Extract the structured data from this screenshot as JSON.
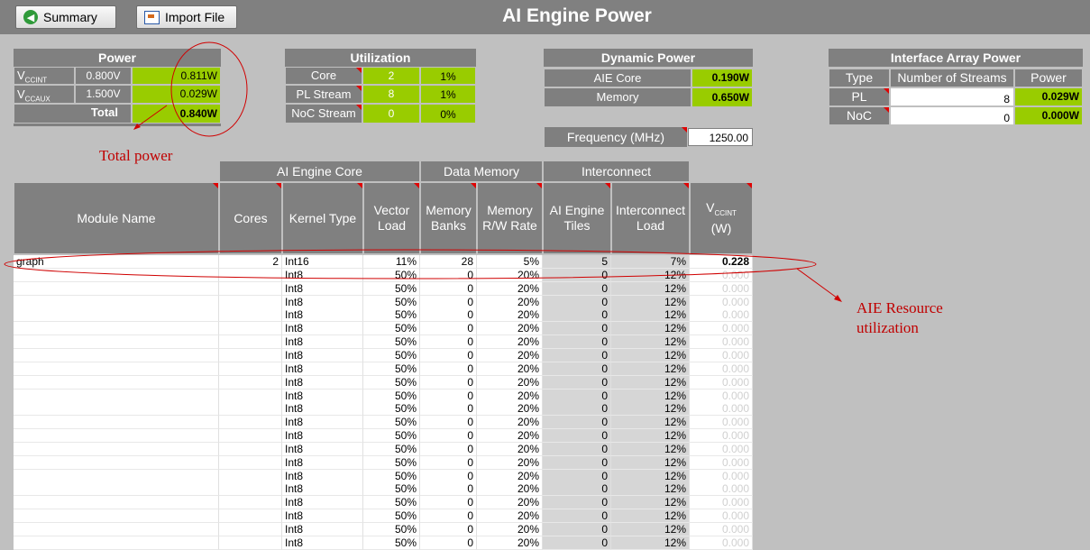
{
  "toolbar": {
    "summary_label": "Summary",
    "import_label": "Import File"
  },
  "title": "AI Engine Power",
  "power": {
    "header": "Power",
    "rows": [
      {
        "label": "V",
        "sub": "CCINT",
        "volt": "0.800V",
        "watt": "0.811W"
      },
      {
        "label": "V",
        "sub": "CCAUX",
        "volt": "1.500V",
        "watt": "0.029W"
      }
    ],
    "total_label": "Total",
    "total_value": "0.840W"
  },
  "utilization": {
    "header": "Utilization",
    "rows": [
      {
        "label": "Core",
        "count": "2",
        "pct": "1%"
      },
      {
        "label": "PL Stream",
        "count": "8",
        "pct": "1%"
      },
      {
        "label": "NoC Stream",
        "count": "0",
        "pct": "0%"
      }
    ]
  },
  "dynamic": {
    "header": "Dynamic Power",
    "rows": [
      {
        "label": "AIE Core",
        "value": "0.190W"
      },
      {
        "label": "Memory",
        "value": "0.650W"
      }
    ],
    "freq_label": "Frequency (MHz)",
    "freq_value": "1250.00"
  },
  "interface": {
    "header": "Interface Array Power",
    "cols": [
      "Type",
      "Number of Streams",
      "Power"
    ],
    "rows": [
      {
        "type": "PL",
        "streams": "8",
        "power": "0.029W"
      },
      {
        "type": "NoC",
        "streams": "0",
        "power": "0.000W"
      }
    ]
  },
  "annotations": {
    "total_power": "Total power",
    "resource_line1": "AIE Resource",
    "resource_line2": "utilization"
  },
  "table": {
    "groups": [
      "AI Engine Core",
      "Data Memory",
      "Interconnect"
    ],
    "headers": {
      "module": "Module Name",
      "cores": "Cores",
      "kernel": "Kernel Type",
      "vector1": "Vector",
      "vector2": "Load",
      "membanks1": "Memory",
      "membanks2": "Banks",
      "memrw1": "Memory",
      "memrw2": "R/W Rate",
      "tiles1": "AI Engine",
      "tiles2": "Tiles",
      "icload1": "Interconnect",
      "icload2": "Load",
      "vcc": "V",
      "vcc_sub": "CCINT",
      "vcc_unit": "(W)"
    },
    "rows": [
      {
        "module": "graph",
        "cores": "2",
        "kernel": "Int16",
        "vector": "11%",
        "banks": "28",
        "rw": "5%",
        "tiles": "5",
        "icload": "7%",
        "vcc": "0.228"
      },
      {
        "module": "",
        "cores": "",
        "kernel": "Int8",
        "vector": "50%",
        "banks": "0",
        "rw": "20%",
        "tiles": "0",
        "icload": "12%",
        "vcc": "0.000"
      },
      {
        "module": "",
        "cores": "",
        "kernel": "Int8",
        "vector": "50%",
        "banks": "0",
        "rw": "20%",
        "tiles": "0",
        "icload": "12%",
        "vcc": "0.000"
      },
      {
        "module": "",
        "cores": "",
        "kernel": "Int8",
        "vector": "50%",
        "banks": "0",
        "rw": "20%",
        "tiles": "0",
        "icload": "12%",
        "vcc": "0.000"
      },
      {
        "module": "",
        "cores": "",
        "kernel": "Int8",
        "vector": "50%",
        "banks": "0",
        "rw": "20%",
        "tiles": "0",
        "icload": "12%",
        "vcc": "0.000"
      },
      {
        "module": "",
        "cores": "",
        "kernel": "Int8",
        "vector": "50%",
        "banks": "0",
        "rw": "20%",
        "tiles": "0",
        "icload": "12%",
        "vcc": "0.000"
      },
      {
        "module": "",
        "cores": "",
        "kernel": "Int8",
        "vector": "50%",
        "banks": "0",
        "rw": "20%",
        "tiles": "0",
        "icload": "12%",
        "vcc": "0.000"
      },
      {
        "module": "",
        "cores": "",
        "kernel": "Int8",
        "vector": "50%",
        "banks": "0",
        "rw": "20%",
        "tiles": "0",
        "icload": "12%",
        "vcc": "0.000"
      },
      {
        "module": "",
        "cores": "",
        "kernel": "Int8",
        "vector": "50%",
        "banks": "0",
        "rw": "20%",
        "tiles": "0",
        "icload": "12%",
        "vcc": "0.000"
      },
      {
        "module": "",
        "cores": "",
        "kernel": "Int8",
        "vector": "50%",
        "banks": "0",
        "rw": "20%",
        "tiles": "0",
        "icload": "12%",
        "vcc": "0.000"
      },
      {
        "module": "",
        "cores": "",
        "kernel": "Int8",
        "vector": "50%",
        "banks": "0",
        "rw": "20%",
        "tiles": "0",
        "icload": "12%",
        "vcc": "0.000"
      },
      {
        "module": "",
        "cores": "",
        "kernel": "Int8",
        "vector": "50%",
        "banks": "0",
        "rw": "20%",
        "tiles": "0",
        "icload": "12%",
        "vcc": "0.000"
      },
      {
        "module": "",
        "cores": "",
        "kernel": "Int8",
        "vector": "50%",
        "banks": "0",
        "rw": "20%",
        "tiles": "0",
        "icload": "12%",
        "vcc": "0.000"
      },
      {
        "module": "",
        "cores": "",
        "kernel": "Int8",
        "vector": "50%",
        "banks": "0",
        "rw": "20%",
        "tiles": "0",
        "icload": "12%",
        "vcc": "0.000"
      },
      {
        "module": "",
        "cores": "",
        "kernel": "Int8",
        "vector": "50%",
        "banks": "0",
        "rw": "20%",
        "tiles": "0",
        "icload": "12%",
        "vcc": "0.000"
      },
      {
        "module": "",
        "cores": "",
        "kernel": "Int8",
        "vector": "50%",
        "banks": "0",
        "rw": "20%",
        "tiles": "0",
        "icload": "12%",
        "vcc": "0.000"
      },
      {
        "module": "",
        "cores": "",
        "kernel": "Int8",
        "vector": "50%",
        "banks": "0",
        "rw": "20%",
        "tiles": "0",
        "icload": "12%",
        "vcc": "0.000"
      },
      {
        "module": "",
        "cores": "",
        "kernel": "Int8",
        "vector": "50%",
        "banks": "0",
        "rw": "20%",
        "tiles": "0",
        "icload": "12%",
        "vcc": "0.000"
      },
      {
        "module": "",
        "cores": "",
        "kernel": "Int8",
        "vector": "50%",
        "banks": "0",
        "rw": "20%",
        "tiles": "0",
        "icload": "12%",
        "vcc": "0.000"
      },
      {
        "module": "",
        "cores": "",
        "kernel": "Int8",
        "vector": "50%",
        "banks": "0",
        "rw": "20%",
        "tiles": "0",
        "icload": "12%",
        "vcc": "0.000"
      },
      {
        "module": "",
        "cores": "",
        "kernel": "Int8",
        "vector": "50%",
        "banks": "0",
        "rw": "20%",
        "tiles": "0",
        "icload": "12%",
        "vcc": "0.000"
      },
      {
        "module": "",
        "cores": "",
        "kernel": "Int8",
        "vector": "50%",
        "banks": "0",
        "rw": "20%",
        "tiles": "0",
        "icload": "12%",
        "vcc": "0.000"
      }
    ]
  },
  "colors": {
    "green": "#99cc00",
    "header_gray": "#808080",
    "annotation_red": "#c00000"
  }
}
